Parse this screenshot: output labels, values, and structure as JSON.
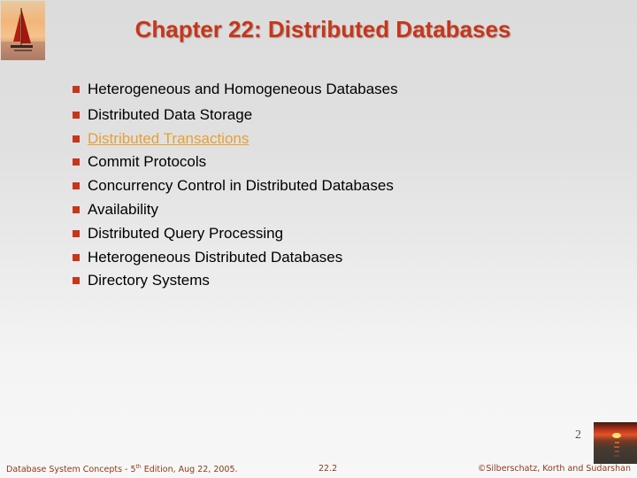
{
  "slide": {
    "title": "Chapter 22: Distributed Databases",
    "bullets": [
      {
        "text": "Heterogeneous and Homogeneous Databases",
        "link": false
      },
      {
        "text": "Distributed Data Storage",
        "link": false
      },
      {
        "text": "Distributed Transactions",
        "link": true
      },
      {
        "text": "Commit Protocols",
        "link": false
      },
      {
        "text": "Concurrency Control in Distributed Databases",
        "link": false
      },
      {
        "text": "Availability",
        "link": false
      },
      {
        "text": "Distributed Query Processing",
        "link": false
      },
      {
        "text": "Heterogeneous Distributed Databases",
        "link": false
      },
      {
        "text": "Directory Systems",
        "link": false
      }
    ],
    "page_number": "2"
  },
  "footer": {
    "left_prefix": "Database System Concepts - 5",
    "left_sup": "th",
    "left_suffix": " Edition, Aug 22, 2005.",
    "center": "22.2",
    "right": "©Silberschatz, Korth and Sudarshan"
  },
  "colors": {
    "accent": "#c8361a",
    "link": "#e8a030",
    "footer_text": "#8b3a1a"
  },
  "icons": {
    "top_logo": "sailboat-sunset-image",
    "bottom_logo": "sunset-over-water-image",
    "bullet": "square-bullet-icon"
  }
}
